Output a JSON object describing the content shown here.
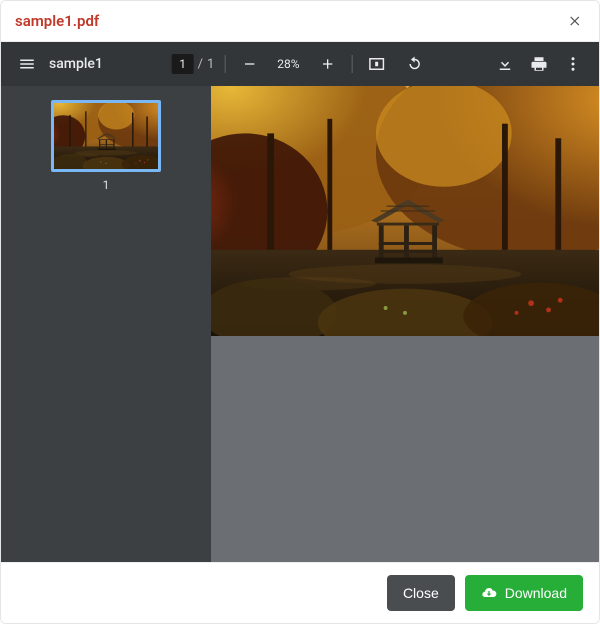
{
  "modal": {
    "title": "sample1.pdf",
    "close_icon": "close-icon"
  },
  "toolbar": {
    "menu_icon": "menu-icon",
    "doc_title": "sample1",
    "page_current": "1",
    "page_separator": "/",
    "page_total": "1",
    "zoom_out_icon": "minus-icon",
    "zoom_level": "28%",
    "zoom_in_icon": "plus-icon",
    "fit_icon": "fit-page-icon",
    "rotate_icon": "rotate-icon",
    "download_icon": "download-icon",
    "print_icon": "print-icon",
    "more_icon": "more-vert-icon"
  },
  "sidebar": {
    "thumbs": [
      {
        "label": "1"
      }
    ]
  },
  "footer": {
    "close_label": "Close",
    "download_label": "Download",
    "download_icon": "cloud-download-icon"
  },
  "colors": {
    "accent_title": "#c0392b",
    "toolbar_bg": "#323639",
    "viewer_bg": "#525659",
    "sidebar_bg": "#3c4043",
    "thumb_border": "#7ab8f5",
    "btn_close_bg": "#4a4d50",
    "btn_download_bg": "#27ae38"
  }
}
